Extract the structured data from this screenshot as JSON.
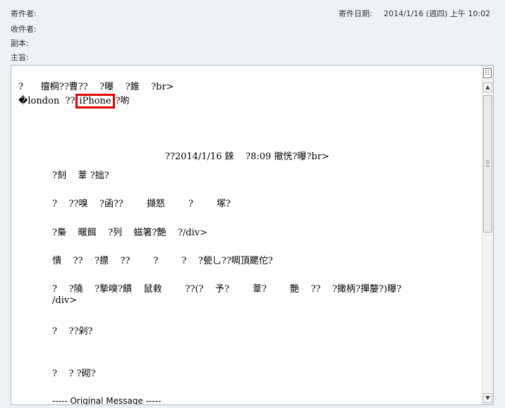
{
  "header": {
    "from_label": "寄件者:",
    "to_label": "收件者:",
    "cc_label": "副本:",
    "subject_label": "主旨:",
    "sent_date_label": "寄件日期:",
    "sent_date_value": "2014/1/16 (週四) 上午 10:02"
  },
  "message": {
    "line1": "?      擅桐??曹??    ?曝    ?錐    ?br>",
    "line2_pre": "�london  ??",
    "line2_highlight": "iPhone",
    "line2_post": "?喲",
    "quote_header": "??2014/1/16 錸    ?8:09 撤恍?曝?br>",
    "q1": "?刻    葦 ?拙?",
    "q2": "?    ??嗅    ?函??        擷怒        ?        塚?",
    "q3": "?梟    暱餌    ?列    螆箸?艶    ?/div>",
    "q4": "憒    ??    ?摽    ??        ?        ?    ?甇乚??啁頂颸佗?",
    "q5a": "?    ?隢    ?摯嗅?饋    鼠敹        ??(?    予?        葦?        艶    ??    ?撖柄?撣嫠?)曝?",
    "q5b": "/div>",
    "q6": "?    ??剁?",
    "q7": "?    ? ?砌?",
    "original_message": "----- Original Message -----"
  },
  "colors": {
    "highlight_border": "#e00000",
    "header_bg": "#eef2f7",
    "pane_border": "#a9b8cc"
  },
  "icons": {
    "top_icon": "message-options-icon",
    "up": "scroll-up-arrow-icon",
    "down": "scroll-down-arrow-icon"
  }
}
